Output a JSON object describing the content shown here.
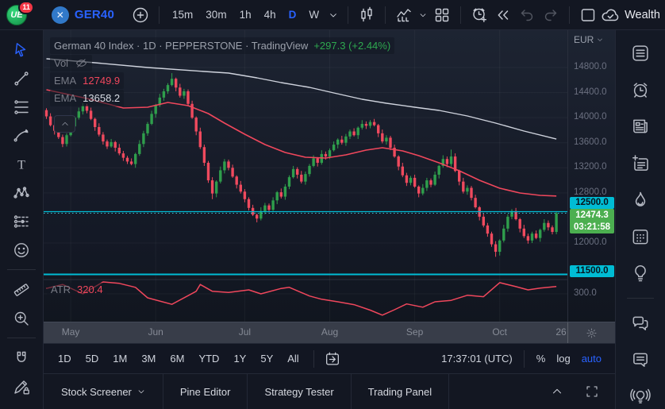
{
  "colors": {
    "accent_blue": "#2962ff",
    "up": "#2f9e4c",
    "down": "#ef4a5e",
    "level_cyan": "#00bcd4",
    "last_tag_green": "#4caf50",
    "ema_fast": "#f0475c",
    "ema_slow": "#cfd3dd",
    "atr_line": "#f0475c",
    "change_green": "#2ea84f",
    "badge_red": "#f23645",
    "grid": "rgba(255,255,255,0.045)"
  },
  "topbar": {
    "badge_count": "11",
    "logo_text": "UE",
    "symbol_circle": "✕",
    "symbol": "GER40",
    "intervals": [
      "15m",
      "30m",
      "1h",
      "4h",
      "D",
      "W"
    ],
    "active_interval": "D",
    "cloud_label": "Wealth",
    "tools": [
      "add-symbol",
      "candles-style",
      "indicators",
      "layout-grid",
      "alert-add",
      "bar-replay",
      "undo",
      "redo",
      "snapshot",
      "cloud-sync"
    ]
  },
  "legend": {
    "title": "German 40 Index · 1D · PEPPERSTONE · TradingView",
    "change": "+297.3 (+2.44%)",
    "vol_label": "Vol",
    "indicators": [
      {
        "label": "EMA",
        "value": "12749.9"
      },
      {
        "label": "EMA",
        "value": "13658.2"
      }
    ],
    "atr_label": "ATR",
    "atr_value": "320.4"
  },
  "price_axis": {
    "currency": "EUR",
    "ticks": [
      "14800.0",
      "14400.0",
      "14000.0",
      "13600.0",
      "13200.0",
      "12800.0",
      "12000.0"
    ],
    "atr_tick": "300.0",
    "level_tags": [
      "12500.0",
      "11500.0"
    ],
    "last_tag": {
      "price": "12474.3",
      "countdown": "03:21:58"
    }
  },
  "time_axis": {
    "labels": [
      {
        "label": "May",
        "bar": 6
      },
      {
        "label": "Jun",
        "bar": 27
      },
      {
        "label": "Jul",
        "bar": 49
      },
      {
        "label": "Aug",
        "bar": 70
      },
      {
        "label": "Sep",
        "bar": 91
      },
      {
        "label": "Oct",
        "bar": 112
      },
      {
        "label": "26",
        "bar": 127.3
      }
    ]
  },
  "range_bar": {
    "ranges": [
      "1D",
      "5D",
      "1M",
      "3M",
      "6M",
      "YTD",
      "1Y",
      "5Y",
      "All"
    ],
    "clock": "17:37:01 (UTC)",
    "percent": "%",
    "log": "log",
    "auto": "auto",
    "active_scale": "auto"
  },
  "tabs": {
    "items": [
      "Stock Screener",
      "Pine Editor",
      "Strategy Tester",
      "Trading Panel"
    ]
  },
  "left_toolbar": {
    "tools": [
      "cursor",
      "trend-line",
      "fib-retracement",
      "brush",
      "text",
      "xabcd-pattern",
      "forecast",
      "emoji",
      "ruler",
      "zoom-in",
      "magnet",
      "drawings-lock"
    ],
    "selected": "cursor"
  },
  "right_sidebar": {
    "items": [
      "watchlist",
      "alerts",
      "news",
      "text-notes",
      "hotlists",
      "calendar",
      "ideas",
      "public-chats",
      "chat",
      "ideas-stream"
    ]
  },
  "chart_data": {
    "type": "candlestick",
    "title": "German 40 Index",
    "interval": "1D",
    "provider": "PEPPERSTONE",
    "currency": "EUR",
    "last_price": 12474.3,
    "change": 297.3,
    "change_pct": 2.44,
    "countdown": "03:21:58",
    "visible_price_range": [
      11400,
      14950
    ],
    "levels": [
      12500,
      11500
    ],
    "candles": [
      [
        14120,
        14150,
        13980,
        14020
      ],
      [
        14020,
        14070,
        13860,
        13880
      ],
      [
        13880,
        13900,
        13730,
        13790
      ],
      [
        13790,
        13850,
        13660,
        13690
      ],
      [
        13690,
        13730,
        13530,
        13580
      ],
      [
        13580,
        13750,
        13540,
        13720
      ],
      [
        13720,
        13910,
        13700,
        13860
      ],
      [
        13860,
        14020,
        13800,
        14000
      ],
      [
        14000,
        14160,
        13970,
        14100
      ],
      [
        14100,
        14230,
        14050,
        14190
      ],
      [
        14190,
        14220,
        14070,
        14110
      ],
      [
        14110,
        14160,
        13960,
        13980
      ],
      [
        13980,
        14000,
        13790,
        13850
      ],
      [
        13850,
        13910,
        13700,
        13730
      ],
      [
        13730,
        13770,
        13570,
        13620
      ],
      [
        13620,
        13650,
        13500,
        13540
      ],
      [
        13540,
        13660,
        13520,
        13610
      ],
      [
        13610,
        13630,
        13460,
        13520
      ],
      [
        13520,
        13580,
        13400,
        13430
      ],
      [
        13430,
        13470,
        13310,
        13360
      ],
      [
        13360,
        13390,
        13260,
        13300
      ],
      [
        13300,
        13350,
        13240,
        13260
      ],
      [
        13260,
        13440,
        13200,
        13420
      ],
      [
        13420,
        13640,
        13390,
        13580
      ],
      [
        13580,
        13790,
        13530,
        13750
      ],
      [
        13750,
        13930,
        13710,
        13900
      ],
      [
        13900,
        14110,
        13880,
        14060
      ],
      [
        14060,
        14220,
        14000,
        14200
      ],
      [
        14200,
        14380,
        14170,
        14320
      ],
      [
        14320,
        14460,
        14270,
        14420
      ],
      [
        14420,
        14550,
        14380,
        14520
      ],
      [
        14520,
        14710,
        14500,
        14620
      ],
      [
        14620,
        14640,
        14420,
        14480
      ],
      [
        14480,
        14540,
        14320,
        14350
      ],
      [
        14350,
        14460,
        14300,
        14420
      ],
      [
        14420,
        14450,
        14180,
        14220
      ],
      [
        14220,
        14270,
        13980,
        14000
      ],
      [
        14000,
        14020,
        13720,
        13780
      ],
      [
        13780,
        13840,
        13500,
        13530
      ],
      [
        13530,
        13570,
        13230,
        13280
      ],
      [
        13280,
        13310,
        12960,
        13000
      ],
      [
        13000,
        13050,
        12700,
        12790
      ],
      [
        12790,
        13000,
        12730,
        12980
      ],
      [
        12980,
        13220,
        12950,
        13160
      ],
      [
        13160,
        13340,
        13110,
        13300
      ],
      [
        13300,
        13330,
        13160,
        13200
      ],
      [
        13200,
        13250,
        13040,
        13060
      ],
      [
        13060,
        13080,
        12870,
        12930
      ],
      [
        12930,
        12990,
        12790,
        12820
      ],
      [
        12820,
        12860,
        12650,
        12700
      ],
      [
        12700,
        12730,
        12520,
        12560
      ],
      [
        12560,
        12610,
        12430,
        12450
      ],
      [
        12450,
        12470,
        12330,
        12390
      ],
      [
        12390,
        12570,
        12360,
        12510
      ],
      [
        12510,
        12640,
        12460,
        12600
      ],
      [
        12600,
        12630,
        12490,
        12530
      ],
      [
        12530,
        12730,
        12510,
        12680
      ],
      [
        12680,
        12830,
        12620,
        12810
      ],
      [
        12810,
        12870,
        12710,
        12740
      ],
      [
        12740,
        12940,
        12690,
        12900
      ],
      [
        12900,
        13080,
        12860,
        13050
      ],
      [
        13050,
        13230,
        13030,
        13180
      ],
      [
        13180,
        13210,
        13030,
        13090
      ],
      [
        13090,
        13150,
        12950,
        12980
      ],
      [
        12980,
        13140,
        12930,
        13100
      ],
      [
        13100,
        13260,
        13060,
        13230
      ],
      [
        13230,
        13400,
        13210,
        13350
      ],
      [
        13350,
        13370,
        13220,
        13280
      ],
      [
        13280,
        13480,
        13250,
        13420
      ],
      [
        13420,
        13460,
        13330,
        13380
      ],
      [
        13380,
        13510,
        13340,
        13480
      ],
      [
        13480,
        13620,
        13460,
        13570
      ],
      [
        13570,
        13670,
        13510,
        13650
      ],
      [
        13650,
        13710,
        13570,
        13600
      ],
      [
        13600,
        13740,
        13550,
        13700
      ],
      [
        13700,
        13810,
        13660,
        13780
      ],
      [
        13780,
        13830,
        13700,
        13720
      ],
      [
        13720,
        13860,
        13660,
        13840
      ],
      [
        13840,
        13960,
        13810,
        13900
      ],
      [
        13900,
        13940,
        13820,
        13870
      ],
      [
        13870,
        13960,
        13830,
        13930
      ],
      [
        13930,
        13980,
        13860,
        13880
      ],
      [
        13880,
        13900,
        13690,
        13750
      ],
      [
        13750,
        13810,
        13590,
        13620
      ],
      [
        13620,
        13720,
        13570,
        13680
      ],
      [
        13680,
        13710,
        13480,
        13520
      ],
      [
        13520,
        13570,
        13360,
        13380
      ],
      [
        13380,
        13400,
        13160,
        13220
      ],
      [
        13220,
        13280,
        13050,
        13080
      ],
      [
        13080,
        13120,
        12910,
        12960
      ],
      [
        12960,
        13070,
        12920,
        13040
      ],
      [
        13040,
        13090,
        12880,
        12900
      ],
      [
        12900,
        12920,
        12730,
        12790
      ],
      [
        12790,
        12940,
        12760,
        12880
      ],
      [
        12880,
        13040,
        12830,
        13000
      ],
      [
        13000,
        13030,
        12890,
        12930
      ],
      [
        12930,
        13140,
        12910,
        13090
      ],
      [
        13090,
        13250,
        13030,
        13230
      ],
      [
        13230,
        13400,
        13200,
        13340
      ],
      [
        13340,
        13380,
        13210,
        13260
      ],
      [
        13260,
        13490,
        13220,
        13380
      ],
      [
        13380,
        13430,
        13130,
        13150
      ],
      [
        13150,
        13170,
        12920,
        12980
      ],
      [
        12980,
        13040,
        12790,
        12820
      ],
      [
        12820,
        12920,
        12770,
        12880
      ],
      [
        12880,
        12910,
        12680,
        12720
      ],
      [
        12720,
        12770,
        12550,
        12570
      ],
      [
        12570,
        12590,
        12360,
        12420
      ],
      [
        12420,
        12480,
        12250,
        12280
      ],
      [
        12280,
        12320,
        12100,
        12150
      ],
      [
        12150,
        12180,
        11940,
        11980
      ],
      [
        11980,
        12030,
        11780,
        11860
      ],
      [
        11860,
        12060,
        11800,
        12040
      ],
      [
        12040,
        12290,
        12010,
        12230
      ],
      [
        12230,
        12460,
        12180,
        12420
      ],
      [
        12420,
        12540,
        12380,
        12510
      ],
      [
        12510,
        12560,
        12360,
        12380
      ],
      [
        12380,
        12400,
        12170,
        12230
      ],
      [
        12230,
        12290,
        12080,
        12110
      ],
      [
        12110,
        12150,
        11990,
        12040
      ],
      [
        12040,
        12180,
        12000,
        12150
      ],
      [
        12150,
        12200,
        12060,
        12080
      ],
      [
        12080,
        12230,
        12020,
        12210
      ],
      [
        12210,
        12380,
        12180,
        12320
      ],
      [
        12320,
        12360,
        12200,
        12250
      ],
      [
        12250,
        12280,
        12137,
        12177
      ],
      [
        12177,
        12495,
        12140,
        12474.3
      ]
    ],
    "ema_fast": {
      "label": "EMA",
      "last": 12749.9,
      "points": [
        [
          0,
          14445
        ],
        [
          10,
          14306
        ],
        [
          19,
          14154
        ],
        [
          25,
          14167
        ],
        [
          30,
          14243
        ],
        [
          35,
          14192
        ],
        [
          40,
          14065
        ],
        [
          44,
          13913
        ],
        [
          49,
          13736
        ],
        [
          54,
          13571
        ],
        [
          59,
          13444
        ],
        [
          64,
          13368
        ],
        [
          69,
          13356
        ],
        [
          74,
          13406
        ],
        [
          79,
          13482
        ],
        [
          83,
          13520
        ],
        [
          88,
          13470
        ],
        [
          92,
          13394
        ],
        [
          97,
          13280
        ],
        [
          102,
          13153
        ],
        [
          107,
          13001
        ],
        [
          112,
          12874
        ],
        [
          117,
          12798
        ],
        [
          122,
          12760
        ],
        [
          126,
          12749.9
        ]
      ]
    },
    "ema_slow": {
      "label": "EMA",
      "last": 13658.2,
      "points": [
        [
          0,
          14939
        ],
        [
          12,
          14876
        ],
        [
          25,
          14800
        ],
        [
          39,
          14737
        ],
        [
          45,
          14711
        ],
        [
          52,
          14635
        ],
        [
          58,
          14559
        ],
        [
          65,
          14483
        ],
        [
          71,
          14395
        ],
        [
          78,
          14293
        ],
        [
          84,
          14230
        ],
        [
          91,
          14167
        ],
        [
          97,
          14116
        ],
        [
          104,
          14027
        ],
        [
          111,
          13913
        ],
        [
          118,
          13787
        ],
        [
          126,
          13658.2
        ]
      ]
    },
    "atr": {
      "label": "ATR",
      "last": 320.4,
      "tick": 300,
      "points": [
        [
          0,
          315
        ],
        [
          4,
          326
        ],
        [
          9,
          300
        ],
        [
          14,
          333
        ],
        [
          18,
          329
        ],
        [
          22,
          318
        ],
        [
          25,
          289
        ],
        [
          31,
          271
        ],
        [
          37,
          307
        ],
        [
          38,
          326
        ],
        [
          41,
          307
        ],
        [
          45,
          304
        ],
        [
          50,
          311
        ],
        [
          53,
          300
        ],
        [
          58,
          315
        ],
        [
          60,
          318
        ],
        [
          65,
          294
        ],
        [
          68,
          285
        ],
        [
          72,
          278
        ],
        [
          76,
          270
        ],
        [
          80,
          255
        ],
        [
          83,
          241
        ],
        [
          86,
          256
        ],
        [
          89,
          272
        ],
        [
          93,
          263
        ],
        [
          96,
          278
        ],
        [
          100,
          282
        ],
        [
          104,
          296
        ],
        [
          108,
          292
        ],
        [
          112,
          331
        ],
        [
          116,
          320
        ],
        [
          119,
          311
        ],
        [
          122,
          316
        ],
        [
          126,
          320.4
        ]
      ]
    }
  }
}
